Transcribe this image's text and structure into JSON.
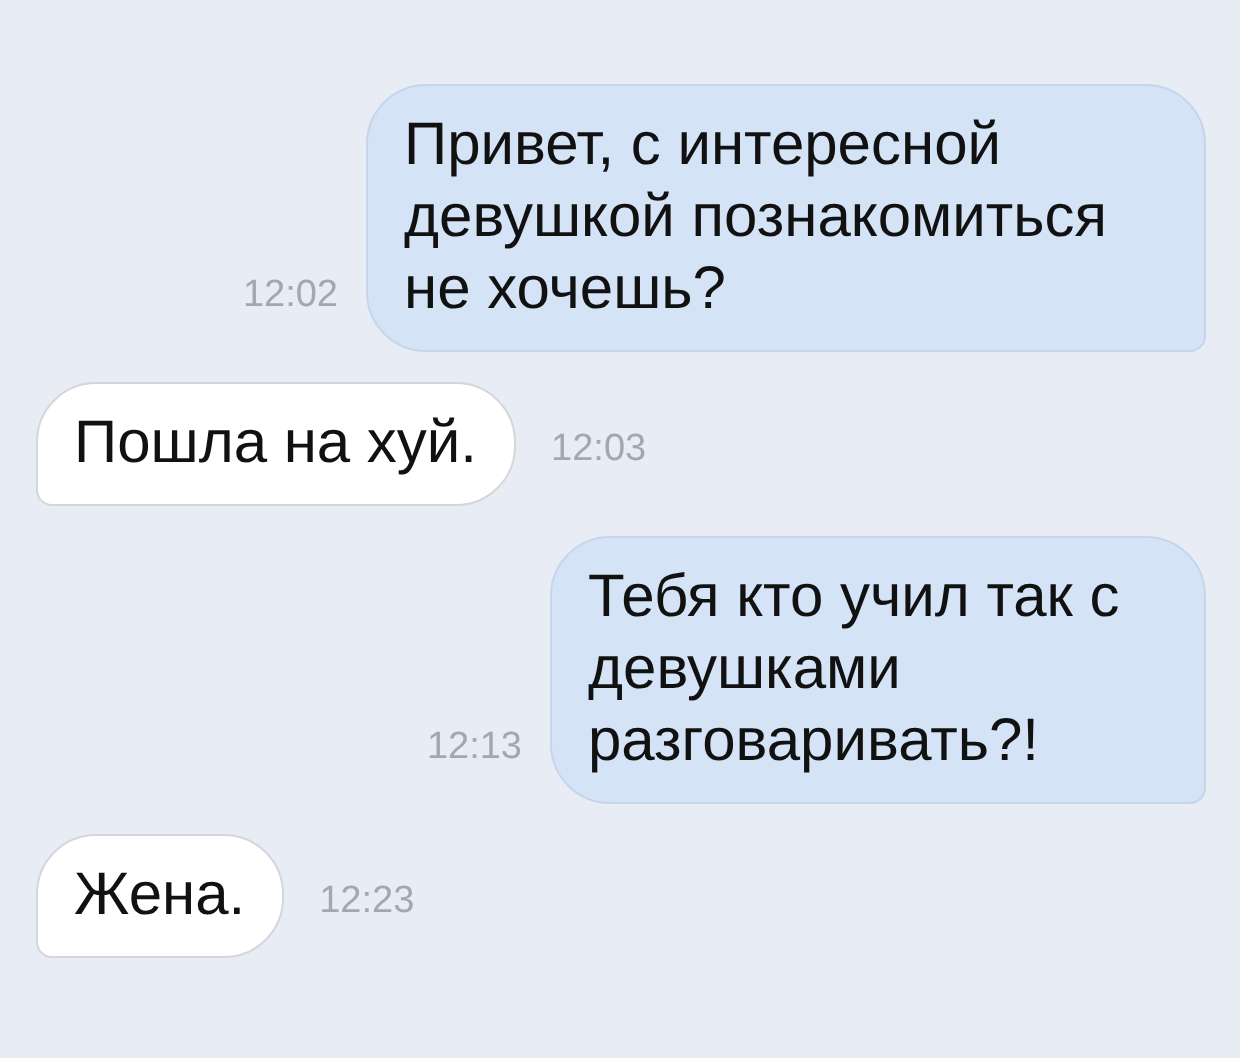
{
  "messages": [
    {
      "kind": "outgoing",
      "text": "Привет, с интересной девушкой познакомиться не хочешь?",
      "time": "12:02"
    },
    {
      "kind": "incoming",
      "text": "Пошла на хуй.",
      "time": "12:03"
    },
    {
      "kind": "outgoing",
      "text": "Тебя кто учил так с девушками разговаривать?!",
      "time": "12:13"
    },
    {
      "kind": "incoming",
      "text": "Жена.",
      "time": "12:23"
    }
  ]
}
